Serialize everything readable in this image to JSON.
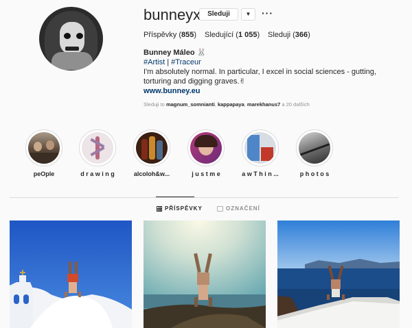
{
  "profile": {
    "username": "bunneyx",
    "follow_label": "Sleduji",
    "dropdown_icon": "chevron-down-icon",
    "more_icon": "ellipsis-icon",
    "stats": {
      "posts_label": "Příspěvky",
      "posts_count": "855",
      "followers_label": "Sledující",
      "followers_count": "1 055",
      "following_label": "Sleduji",
      "following_count": "366"
    },
    "full_name": "Bunney Máleo 🐰",
    "tag1": "#Artist",
    "tag_sep": " | ",
    "tag2": "#Traceur",
    "bio": "I'm absolutely normal. In particular, I excel in social sciences - gutting, torturing and digging graves.✌",
    "website": "www.bunney.eu",
    "followed_by_prefix": "Sleduji to",
    "followed_by_users": [
      "magnum_somnianti",
      "kappapaya",
      "marekhanus7"
    ],
    "followed_by_suffix": "a 20 dalších"
  },
  "highlights": [
    {
      "label": "peOple"
    },
    {
      "label": "d r a w i n g"
    },
    {
      "label": "alcoloh&w..."
    },
    {
      "label": "j u s t m e"
    },
    {
      "label": "a w T h i n ..."
    },
    {
      "label": "p h o t o s"
    }
  ],
  "tabs": {
    "posts_label": "PŘÍSPĚVKY",
    "tagged_label": "OZNAČENÍ"
  },
  "colors": {
    "background": "#fafafa",
    "link": "#00376b",
    "muted": "#8e8e8e",
    "border": "#dbdbdb"
  }
}
